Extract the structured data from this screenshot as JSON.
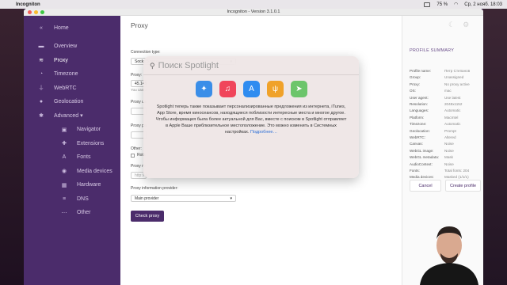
{
  "menubar": {
    "app_name": "Incogniton",
    "right_status": "75 %",
    "datetime": "Ср, 2 нояб.  18:03"
  },
  "window": {
    "title": "Incogniton - Version 3.1.0.1"
  },
  "sidebar": {
    "home_label": "Home",
    "items": [
      {
        "label": "Overview",
        "icon": "grid-icon"
      },
      {
        "label": "Proxy",
        "icon": "wifi-icon"
      },
      {
        "label": "Timezone",
        "icon": "clock-icon"
      },
      {
        "label": "WebRTC",
        "icon": "plug-icon"
      },
      {
        "label": "Geolocation",
        "icon": "pin-icon"
      },
      {
        "label": "Advanced ▾",
        "icon": "asterisk-icon"
      }
    ],
    "advanced_items": [
      {
        "label": "Navigator",
        "icon": "browser-icon"
      },
      {
        "label": "Extensions",
        "icon": "puzzle-icon"
      },
      {
        "label": "Fonts",
        "icon": "font-icon"
      },
      {
        "label": "Media devices",
        "icon": "media-icon"
      },
      {
        "label": "Hardware",
        "icon": "chip-icon"
      },
      {
        "label": "DNS",
        "icon": "dns-icon"
      },
      {
        "label": "Other",
        "icon": "ellipsis-icon"
      }
    ]
  },
  "main": {
    "title": "Proxy",
    "connection_type_label": "Connection type:",
    "connection_type_value": "Socks 5 proxy",
    "proxy_label": "Proxy:",
    "proxy_value": "45.145",
    "proxy_hint": "You can p",
    "proxy_user_label": "Proxy us",
    "proxy_pass_label": "Proxy pa",
    "other_label": "Other:",
    "rotating_label": "Rota",
    "proxy_rotation_label": "Proxy ro",
    "rotation_placeholder": "http://ex",
    "provider_label": "Proxy information provider:",
    "provider_value": "Main provider",
    "check_button": "Check proxy"
  },
  "summary": {
    "title": "PROFILE SUMMARY",
    "rows": [
      {
        "k": "Profile name:",
        "v": "Петр Степанов"
      },
      {
        "k": "Group:",
        "v": "Unassigned"
      },
      {
        "k": "Proxy:",
        "v": "No proxy active"
      },
      {
        "k": "OS:",
        "v": "mac"
      },
      {
        "k": "User agent:",
        "v": "Use latest"
      },
      {
        "k": "Resolution:",
        "v": "2048x1152"
      },
      {
        "k": "Languages:",
        "v": "Automatic"
      },
      {
        "k": "Platform:",
        "v": "MacIntel"
      },
      {
        "k": "Timezone:",
        "v": "Automatic"
      },
      {
        "k": "Geolocation:",
        "v": "Prompt"
      },
      {
        "k": "WebRTC:",
        "v": "Altered"
      },
      {
        "k": "Canvas:",
        "v": "Noise"
      },
      {
        "k": "WebGL image:",
        "v": "Noise"
      },
      {
        "k": "WebGL metadata:",
        "v": "Mask"
      },
      {
        "k": "AudioContext:",
        "v": "Noise"
      },
      {
        "k": "Fonts:",
        "v": "Total fonts: 204"
      },
      {
        "k": "Media devices:",
        "v": "Masked (1/1/1)"
      }
    ],
    "cancel_button": "Cancel",
    "create_button": "Create profile"
  },
  "spotlight": {
    "placeholder": "Поиск Spotlight",
    "text": "Spotlight теперь также показывает персонализированные предложения из интернета, iTunes, App Store, время киносеансов, находящиеся поблизости интересные места и многое другое. Чтобы информация была более актуальной для Вас, вместе с поиском в Spotlight отправляет в Apple Ваше приблизительное местоположение. Это можно изменить в Системных настройках.",
    "link": "Подробнее…",
    "apps": [
      {
        "icon": "safari-icon",
        "color": "#3a8ee8"
      },
      {
        "icon": "music-icon",
        "color": "#f0455a"
      },
      {
        "icon": "app-store-icon",
        "color": "#2f8cf0"
      },
      {
        "icon": "restaurant-icon",
        "color": "#f0a22a"
      },
      {
        "icon": "maps-icon",
        "color": "#6cc56b"
      }
    ]
  }
}
